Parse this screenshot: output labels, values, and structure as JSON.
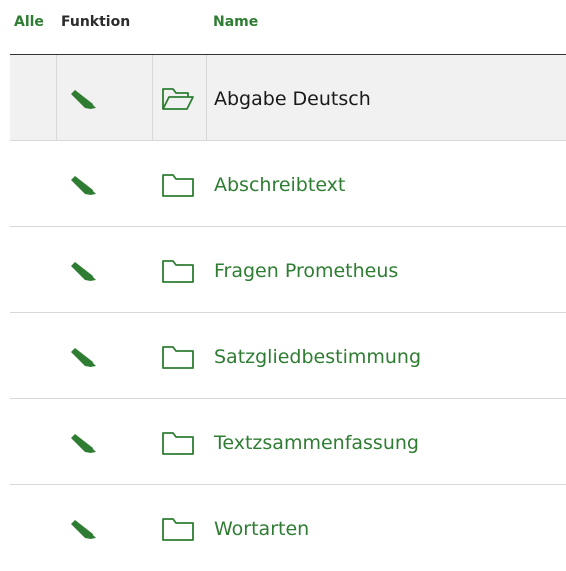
{
  "header": {
    "select_all_label": "Alle",
    "function_label": "Funktion",
    "name_label": "Name"
  },
  "colors": {
    "accent": "#2e7d32",
    "row_highlight": "#f1f1f1"
  },
  "rows": [
    {
      "name": "Abgabe Deutsch",
      "icon": "folder-open-icon",
      "selected": true
    },
    {
      "name": "Abschreibtext",
      "icon": "folder-icon",
      "selected": false
    },
    {
      "name": "Fragen Prometheus",
      "icon": "folder-icon",
      "selected": false
    },
    {
      "name": "Satzgliedbestimmung",
      "icon": "folder-icon",
      "selected": false
    },
    {
      "name": "Textzsammenfassung",
      "icon": "folder-icon",
      "selected": false
    },
    {
      "name": "Wortarten",
      "icon": "folder-icon",
      "selected": false
    }
  ]
}
